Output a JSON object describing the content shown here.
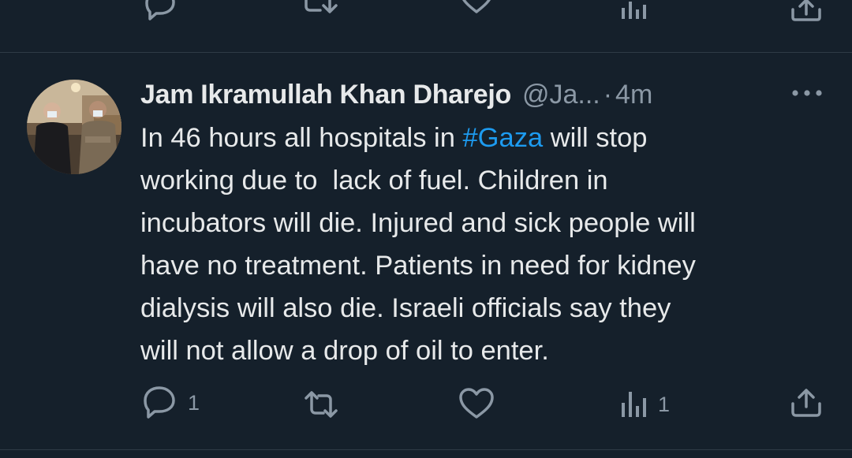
{
  "previous_tweet_actions": {
    "reply_icon": "reply-icon",
    "retweet_icon": "retweet-icon",
    "like_icon": "like-icon",
    "views_icon": "views-icon",
    "share_icon": "share-icon"
  },
  "tweet": {
    "author_name": "Jam Ikramullah Khan Dharejo",
    "handle": "@Ja...",
    "separator": "·",
    "time": "4m",
    "more_icon": "more-icon",
    "text_lines": [
      {
        "before": "In 46 hours all hospitals in ",
        "hashtag": "#Gaza",
        "after": " will stop"
      },
      {
        "text": "working due to  lack of fuel. Children in"
      },
      {
        "text": "incubators will die. Injured and sick people will"
      },
      {
        "text": "have no treatment. Patients in need for kidney"
      },
      {
        "text": "dialysis will also die. Israeli officials say they"
      },
      {
        "text": "will not allow a drop of oil to enter."
      }
    ],
    "actions": {
      "reply_count": "1",
      "retweet_count": "",
      "like_count": "",
      "views_count": "1"
    }
  },
  "colors": {
    "background": "#15202b",
    "text": "#e7e9ea",
    "secondary": "#8b98a5",
    "accent": "#1d9bf0",
    "divider": "#2f3b46"
  }
}
